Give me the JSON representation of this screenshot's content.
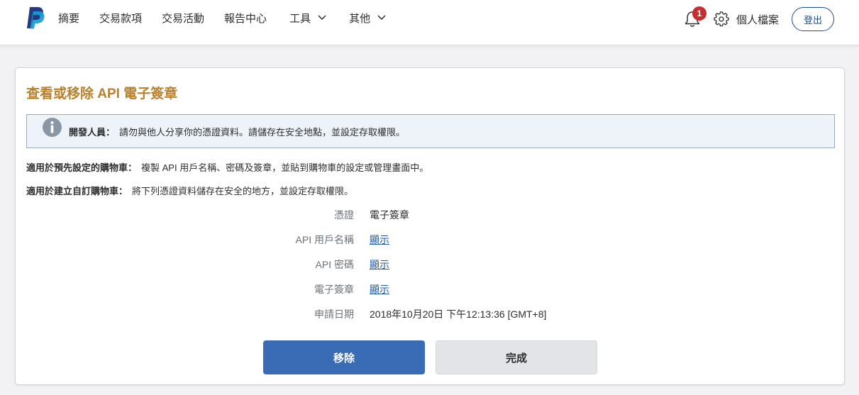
{
  "header": {
    "nav": [
      "摘要",
      "交易款項",
      "交易活動",
      "報告中心",
      "工具",
      "其他"
    ],
    "notification_count": "1",
    "profile_label": "個人檔案",
    "logout_label": "登出"
  },
  "card": {
    "title": "查看或移除 API 電子簽章",
    "notice_label": "開發人員：",
    "notice_text": "請勿與他人分享你的憑證資料。請儲存在安全地點，並設定存取權限。",
    "line1_label": "適用於預先設定的購物車：",
    "line1_text": "複製 API 用戶名稱、密碼及簽章，並貼到購物車的設定或管理畫面中。",
    "line2_label": "適用於建立自訂購物車：",
    "line2_text": "將下列憑證資料儲存在安全的地方，並設定存取權限。",
    "fields": [
      {
        "label": "憑證",
        "value": "電子簽章"
      },
      {
        "label": "API 用戶名稱",
        "value": "顯示"
      },
      {
        "label": "API 密碼",
        "value": "顯示"
      },
      {
        "label": "電子簽章",
        "value": "顯示"
      },
      {
        "label": "申請日期",
        "value": "2018年10月20日 下午12:13:36 [GMT+8]"
      }
    ],
    "remove_label": "移除",
    "done_label": "完成"
  },
  "colors": {
    "brand_blue": "#3a6bb5",
    "title_gold": "#b8812d",
    "badge_red": "#c72e2e",
    "link_blue": "#1f5aa8"
  }
}
